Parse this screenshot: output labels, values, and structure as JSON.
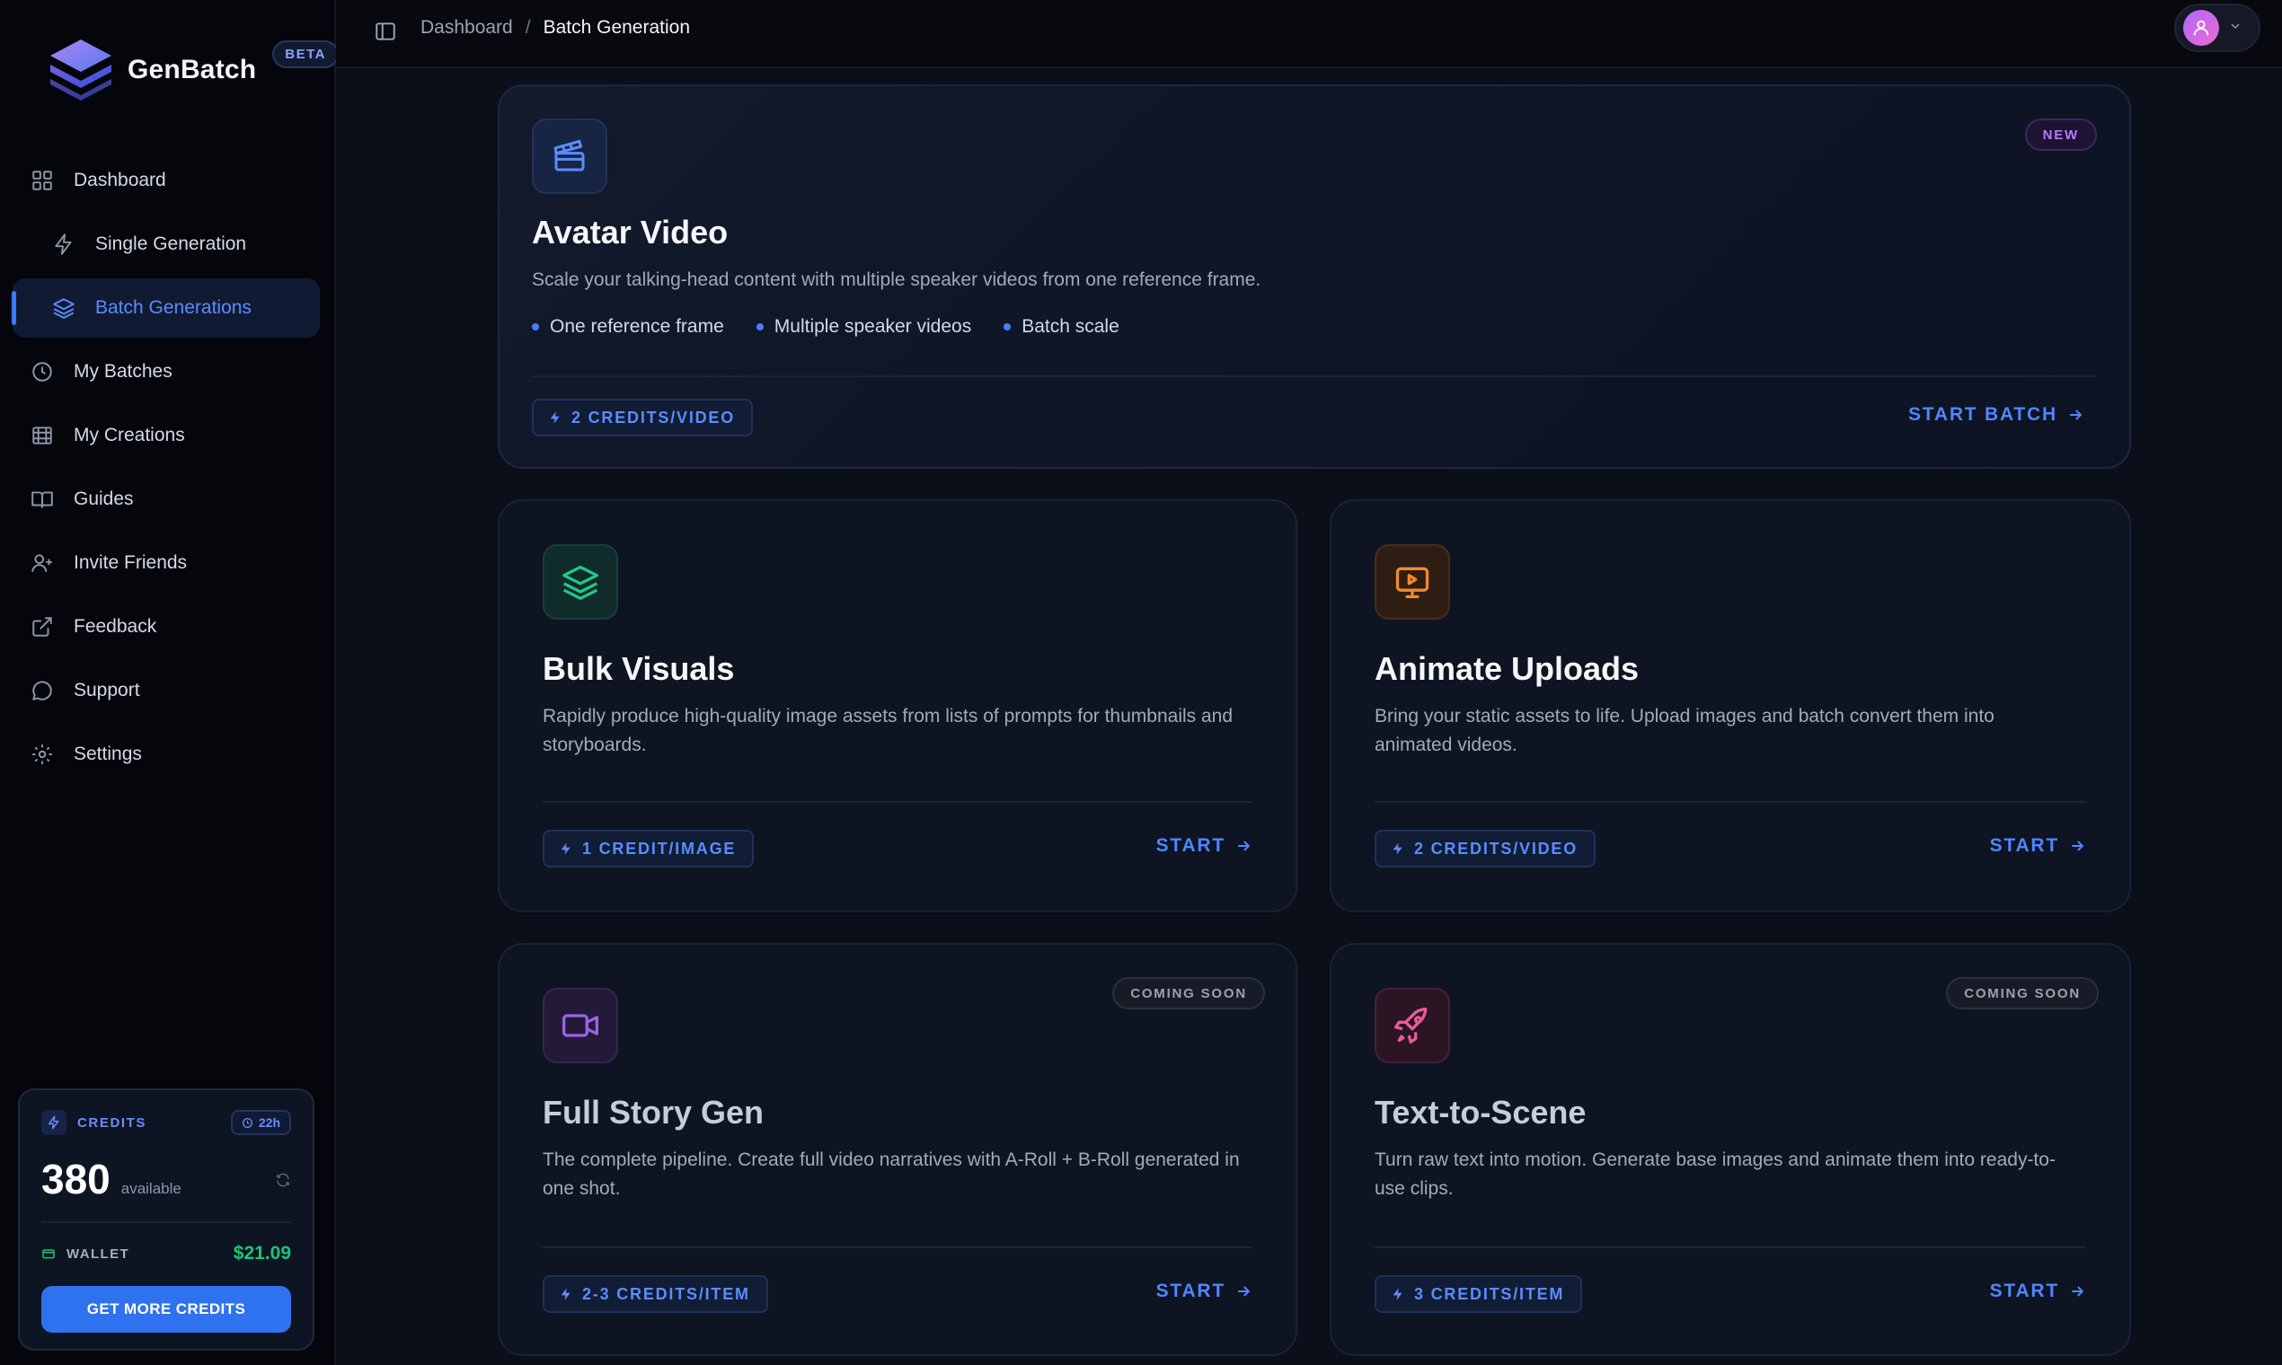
{
  "brand": {
    "name": "GenBatch",
    "badge": "BETA"
  },
  "nav": {
    "items": [
      {
        "label": "Dashboard",
        "icon": "grid-icon"
      },
      {
        "label": "Single Generation",
        "icon": "bolt-icon"
      },
      {
        "label": "Batch Generations",
        "icon": "layers-icon"
      },
      {
        "label": "My Batches",
        "icon": "clock-icon"
      },
      {
        "label": "My Creations",
        "icon": "film-icon"
      },
      {
        "label": "Guides",
        "icon": "book-icon"
      },
      {
        "label": "Invite Friends",
        "icon": "user-plus-icon"
      },
      {
        "label": "Feedback",
        "icon": "external-link-icon"
      },
      {
        "label": "Support",
        "icon": "chat-icon"
      },
      {
        "label": "Settings",
        "icon": "gear-icon"
      }
    ]
  },
  "credits": {
    "label": "CREDITS",
    "timer": "22h",
    "amount": "380",
    "available_label": "available",
    "wallet_label": "WALLET",
    "wallet_value": "$21.09",
    "button_label": "GET MORE CREDITS"
  },
  "breadcrumb": {
    "parent": "Dashboard",
    "separator": "/",
    "current": "Batch Generation"
  },
  "hero": {
    "badge": "NEW",
    "title": "Avatar Video",
    "description": "Scale your talking-head content with multiple speaker videos from one reference frame.",
    "features": [
      "One reference frame",
      "Multiple speaker videos",
      "Batch scale"
    ],
    "credit": "2 CREDITS/VIDEO",
    "action": "START BATCH"
  },
  "cards": [
    {
      "title": "Bulk Visuals",
      "description": "Rapidly produce high-quality image assets from lists of prompts for thumbnails and storyboards.",
      "credit": "1 CREDIT/IMAGE",
      "action": "START",
      "badge": ""
    },
    {
      "title": "Animate Uploads",
      "description": "Bring your static assets to life. Upload images and batch convert them into animated videos.",
      "credit": "2 CREDITS/VIDEO",
      "action": "START",
      "badge": ""
    },
    {
      "title": "Full Story Gen",
      "description": "The complete pipeline. Create full video narratives with A-Roll + B-Roll generated in one shot.",
      "credit": "2-3 CREDITS/ITEM",
      "action": "START",
      "badge": "COMING SOON"
    },
    {
      "title": "Text-to-Scene",
      "description": "Turn raw text into motion. Generate base images and animate them into ready-to-use clips.",
      "credit": "3 CREDITS/ITEM",
      "action": "START",
      "badge": "COMING SOON"
    }
  ],
  "colors": {
    "accent": "#3b78ff",
    "wallet": "#18c77a",
    "new_badge": "#b57bff"
  }
}
